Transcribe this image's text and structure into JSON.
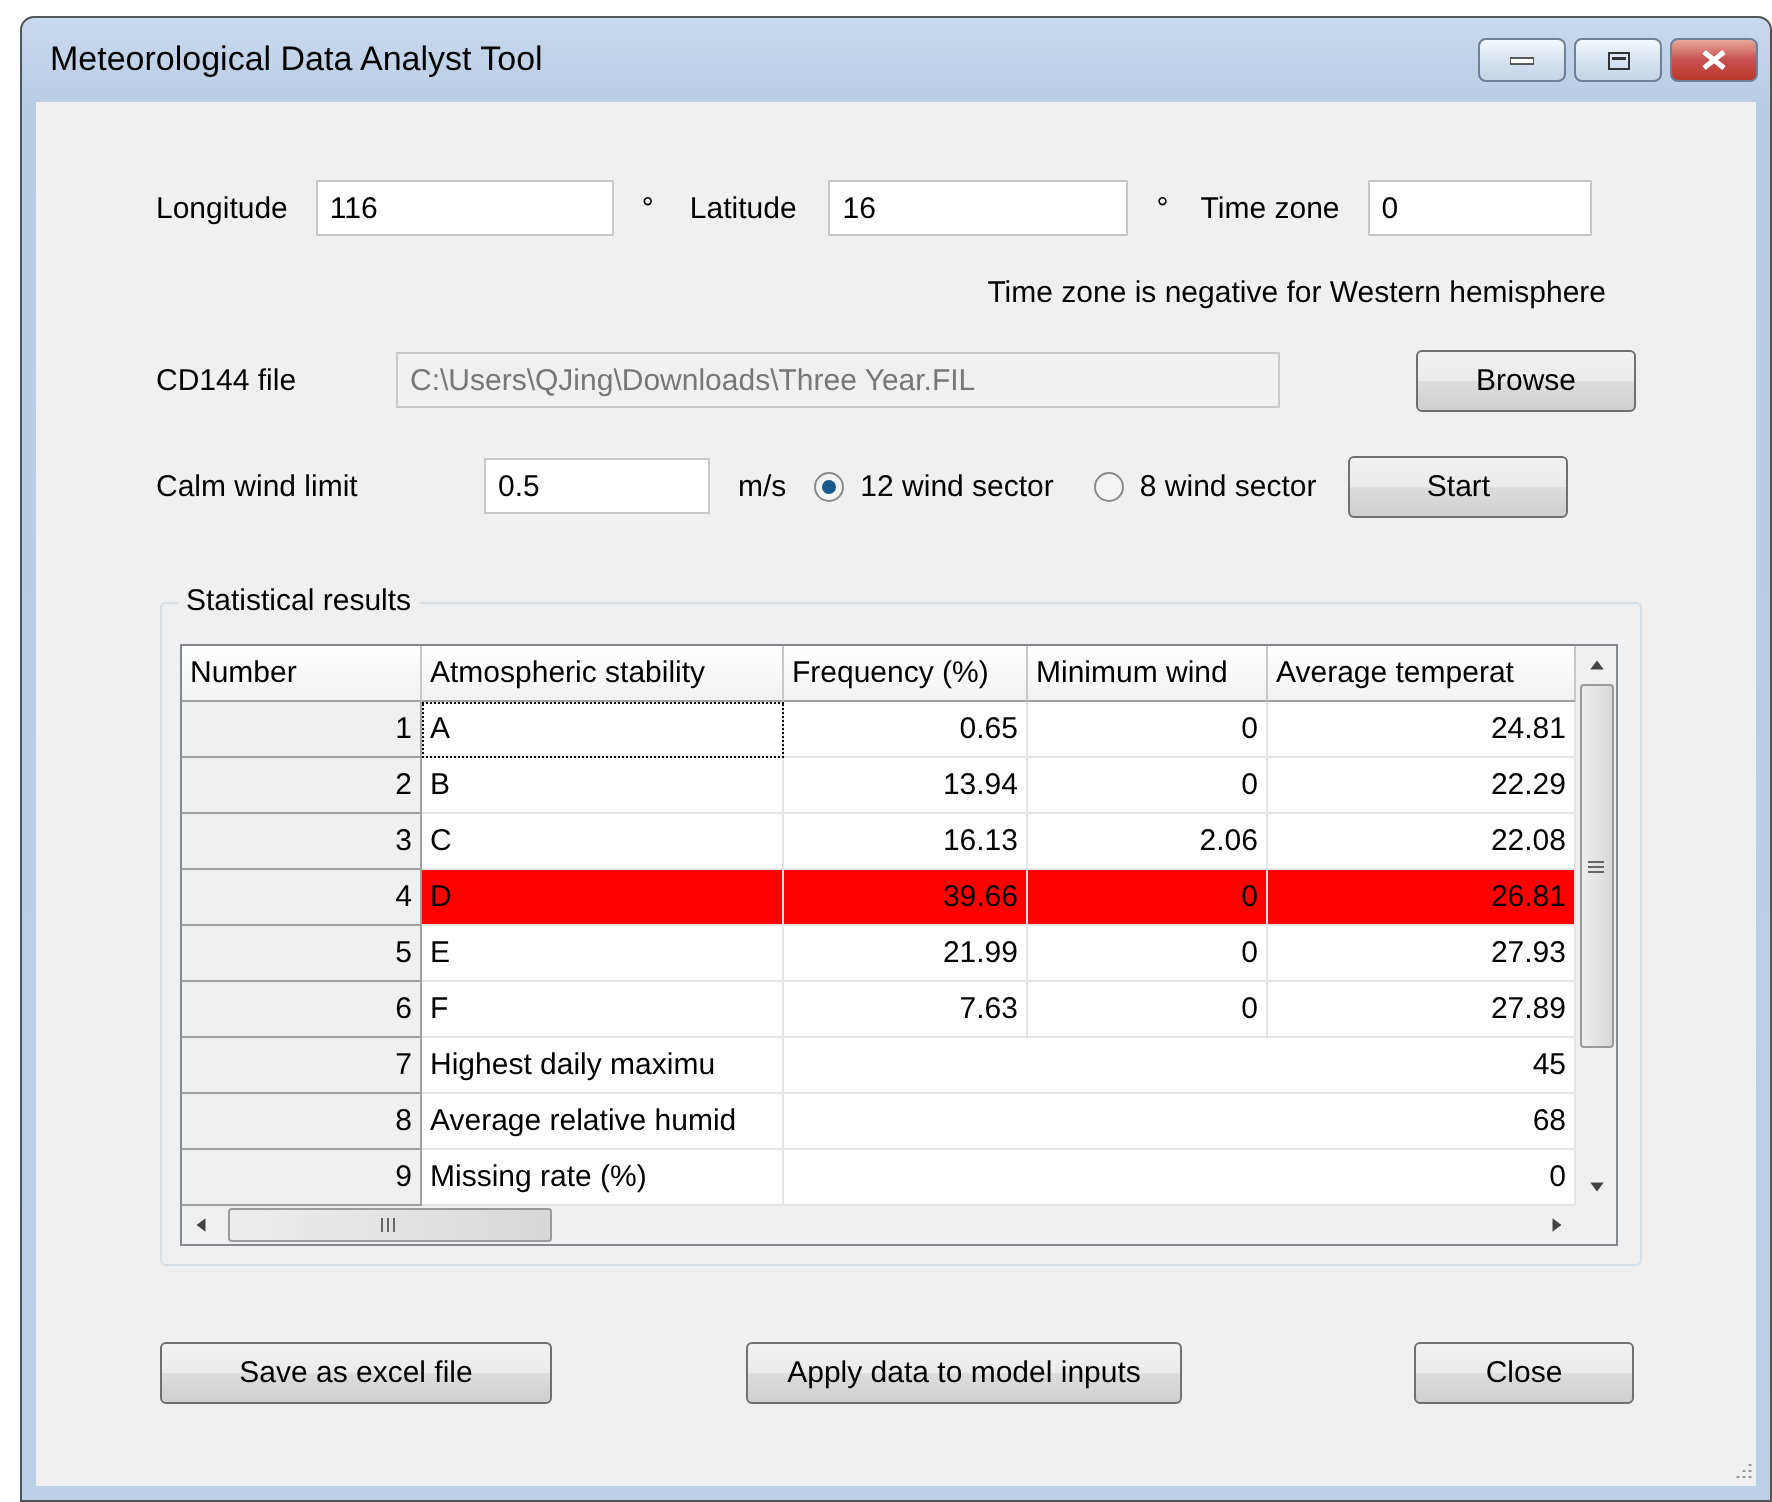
{
  "window": {
    "title": "Meteorological Data Analyst Tool"
  },
  "location": {
    "longitude_label": "Longitude",
    "longitude": "116",
    "longitude_unit": "°",
    "latitude_label": "Latitude",
    "latitude": "16",
    "latitude_unit": "°",
    "timezone_label": "Time zone",
    "timezone": "0",
    "note": "Time zone is negative for Western hemisphere"
  },
  "file": {
    "label": "CD144 file",
    "path": "C:\\Users\\QJing\\Downloads\\Three Year.FIL",
    "disabled": true,
    "button": "Browse"
  },
  "calm": {
    "label": "Calm wind limit",
    "value": "0.5",
    "unit": "m/s",
    "button": "Start"
  },
  "sectors": [
    {
      "label": "12 wind sector",
      "selected": true
    },
    {
      "label": "8 wind sector",
      "selected": false
    }
  ],
  "results": {
    "title": "Statistical results",
    "columns": [
      "Number",
      "Atmospheric stability",
      "Frequency (%)",
      "Minimum wind",
      "Average temperat"
    ],
    "rows": [
      {
        "kind": "stability",
        "cells": [
          "1",
          "A",
          "0.65",
          "0",
          "24.81"
        ],
        "selected": false,
        "focused": true
      },
      {
        "kind": "stability",
        "cells": [
          "2",
          "B",
          "13.94",
          "0",
          "22.29"
        ],
        "selected": false,
        "focused": false
      },
      {
        "kind": "stability",
        "cells": [
          "3",
          "C",
          "16.13",
          "2.06",
          "22.08"
        ],
        "selected": false,
        "focused": false
      },
      {
        "kind": "stability",
        "cells": [
          "4",
          "D",
          "39.66",
          "0",
          "26.81"
        ],
        "selected": true,
        "focused": false
      },
      {
        "kind": "stability",
        "cells": [
          "5",
          "E",
          "21.99",
          "0",
          "27.93"
        ],
        "selected": false,
        "focused": false
      },
      {
        "kind": "stability",
        "cells": [
          "6",
          "F",
          "7.63",
          "0",
          "27.89"
        ],
        "selected": false,
        "focused": false
      },
      {
        "kind": "summary",
        "cells": [
          "7",
          "Highest daily maximu",
          "45"
        ],
        "selected": false,
        "focused": false
      },
      {
        "kind": "summary",
        "cells": [
          "8",
          "Average relative humid",
          "68"
        ],
        "selected": false,
        "focused": false
      },
      {
        "kind": "summary",
        "cells": [
          "9",
          "Missing rate (%)",
          "0"
        ],
        "selected": false,
        "focused": false
      }
    ]
  },
  "buttons": [
    "Save as excel file",
    "Apply data to model inputs",
    "Close"
  ]
}
